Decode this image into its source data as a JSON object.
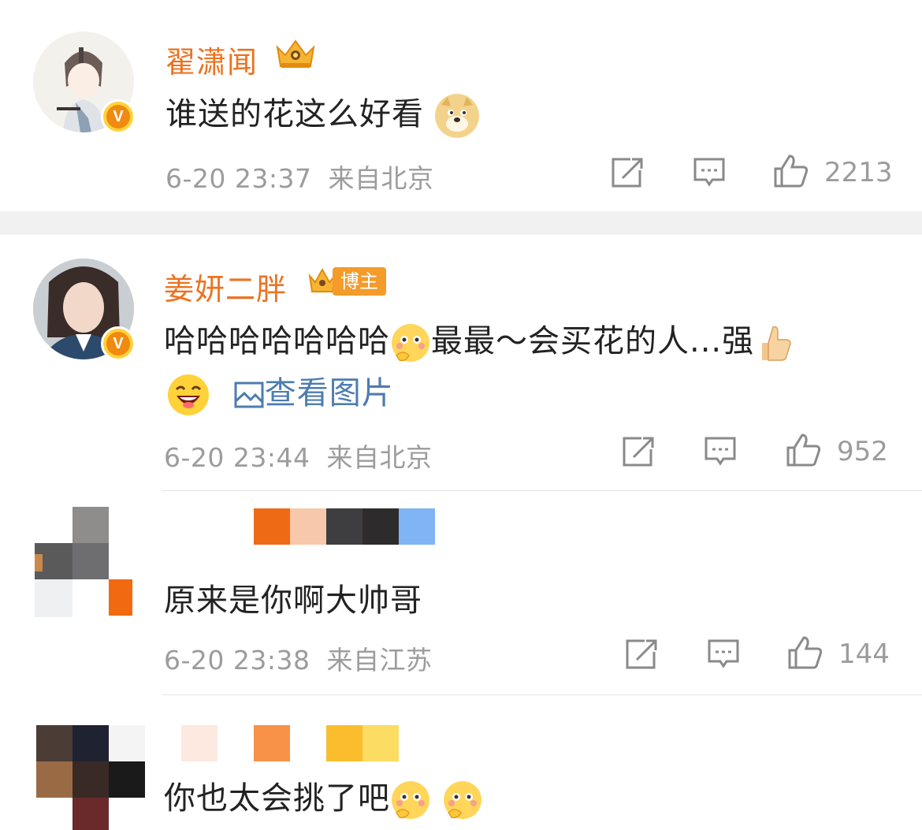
{
  "comments": [
    {
      "username": "翟潇闻",
      "text": "谁送的花这么好看",
      "time": "6-20 23:37",
      "location": "来自北京",
      "likes": "2213",
      "badge": "crown-icon"
    },
    {
      "username": "姜妍二胖",
      "badge_label": "博主",
      "text_line1": "哈哈哈哈哈哈哈",
      "text_mid": "最最～会买花的人...强",
      "view_image_label": "查看图片",
      "time": "6-20 23:44",
      "location": "来自北京",
      "likes": "952"
    },
    {
      "text": "原来是你啊大帅哥",
      "time": "6-20 23:38",
      "location": "来自江苏",
      "likes": "144"
    },
    {
      "text": "你也太会挑了吧"
    }
  ],
  "colors": {
    "username": "#eb7322",
    "meta": "#9c9c9c",
    "link": "#4d7cb0",
    "separator": "#f1f1f1"
  }
}
